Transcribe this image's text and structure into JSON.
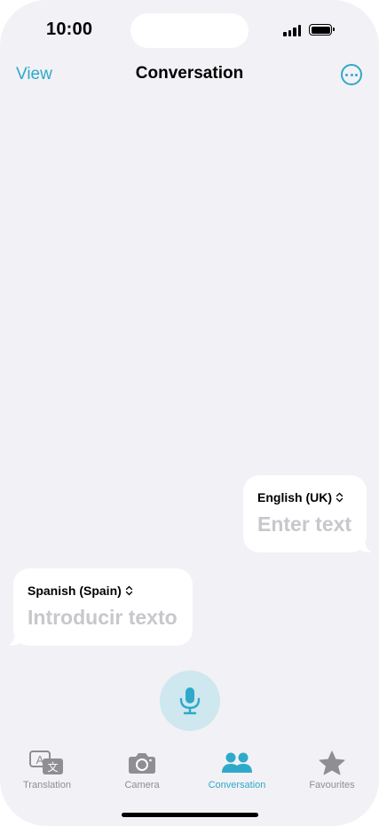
{
  "status_bar": {
    "time": "10:00"
  },
  "nav": {
    "left_label": "View",
    "title": "Conversation",
    "more_icon": "ellipsis-circle-icon"
  },
  "conversation": {
    "target": {
      "language": "English (UK)",
      "placeholder": "Enter text"
    },
    "source": {
      "language": "Spanish (Spain)",
      "placeholder": "Introducir texto"
    }
  },
  "mic": {
    "icon": "microphone-icon"
  },
  "tabs": [
    {
      "label": "Translation",
      "icon": "translate-icon",
      "active": false
    },
    {
      "label": "Camera",
      "icon": "camera-icon",
      "active": false
    },
    {
      "label": "Conversation",
      "icon": "people-icon",
      "active": true
    },
    {
      "label": "Favourites",
      "icon": "star-icon",
      "active": false
    }
  ],
  "colors": {
    "accent": "#2fa9c9",
    "background": "#f2f1f6",
    "mic_background": "#cfe7ef",
    "placeholder": "#c7c7cc",
    "inactive_tab": "#8e8e93"
  }
}
